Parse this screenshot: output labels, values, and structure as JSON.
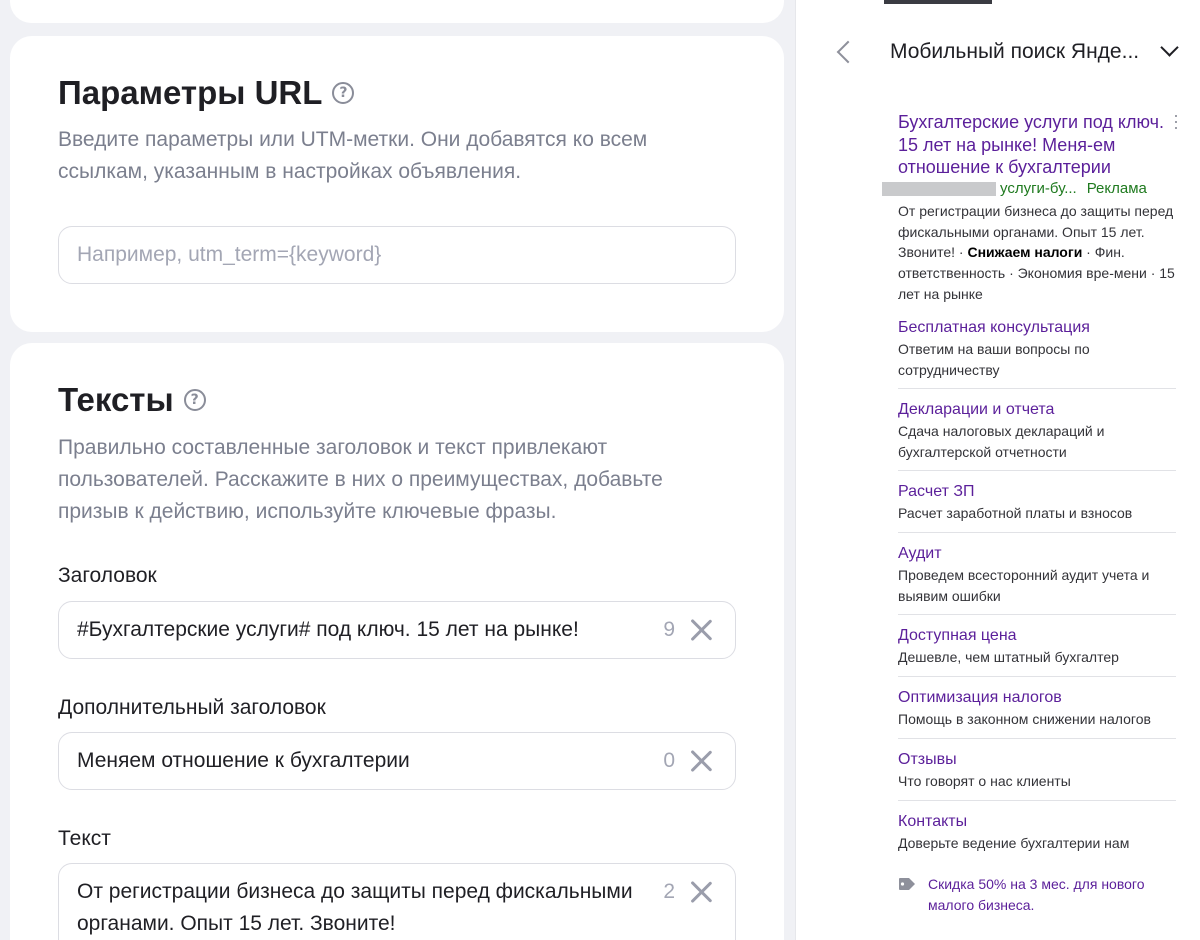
{
  "url_params": {
    "title": "Параметры URL",
    "description": "Введите параметры или UTM-метки. Они добавятся ко всем ссылкам, указанным в настройках объявления.",
    "input_placeholder": "Например, utm_term={keyword}"
  },
  "texts": {
    "title": "Тексты",
    "description": "Правильно составленные заголовок и текст привлекают пользователей. Расскажите в них о преимуществах, добавьте призыв к действию, используйте ключевые фразы.",
    "headline": {
      "label": "Заголовок",
      "value": "#Бухгалтерские услуги# под ключ. 15 лет на рынке!",
      "counter": "9"
    },
    "extra_headline": {
      "label": "Дополнительный заголовок",
      "value": "Меняем отношение к бухгалтерии",
      "counter": "0"
    },
    "body": {
      "label": "Текст",
      "value": "От регистрации бизнеса до защиты перед фискальными органами. Опыт 15 лет. Звоните!",
      "counter": "2"
    }
  },
  "preview": {
    "device_title": "Мобильный поиск Янде...",
    "ad": {
      "title": "Бухгалтерские услуги под ключ. 15 лет на рынке! Меня-ем отношение к бухгалтерии",
      "domain": "услуги-бу...",
      "ad_label": "Реклама",
      "desc_part1": "От регистрации бизнеса до защиты перед фискальными органами. Опыт 15 лет. Звоните! · ",
      "desc_bold": "Снижаем налоги",
      "desc_part2": " · Фин. ответственность · Экономия вре-мени · 15 лет на рынке"
    },
    "sitelinks": [
      {
        "title": "Бесплатная консультация",
        "desc": "Ответим на ваши вопросы по сотрудничеству"
      },
      {
        "title": "Декларации и отчета",
        "desc": "Сдача налоговых деклараций и бухгалтерской отчетности"
      },
      {
        "title": "Расчет ЗП",
        "desc": "Расчет заработной платы и взносов"
      },
      {
        "title": "Аудит",
        "desc": "Проведем всесторонний аудит учета и выявим ошибки"
      },
      {
        "title": "Доступная цена",
        "desc": "Дешевле, чем штатный бухгалтер"
      },
      {
        "title": "Оптимизация налогов",
        "desc": "Помощь в законном снижении налогов"
      },
      {
        "title": "Отзывы",
        "desc": "Что говорят о нас клиенты"
      },
      {
        "title": "Контакты",
        "desc": "Доверьте ведение бухгалтерии нам"
      }
    ],
    "promo": "Скидка 50% на 3 мес. для нового малого бизнеса."
  },
  "icons": {
    "help": "question-circle-icon",
    "clear": "close-icon",
    "back": "chevron-left-icon",
    "dropdown": "chevron-down-icon",
    "promo": "price-tag-icon",
    "menu": "kebab-menu-icon"
  },
  "colors": {
    "link": "#5b1f9a",
    "ad_green": "#1f7a1f",
    "page_bg": "#f0f1f5"
  }
}
